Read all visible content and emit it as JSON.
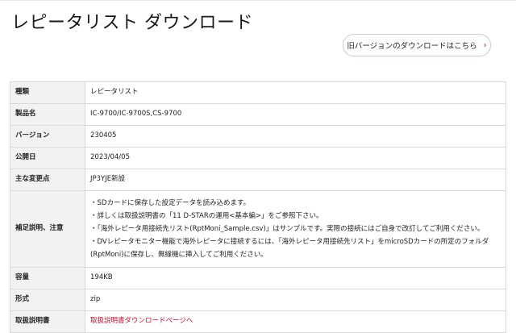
{
  "page": {
    "title": "レピータリスト ダウンロード",
    "old_version_button": "旧バージョンのダウンロードはこちら",
    "old_version_chevron": "›"
  },
  "spec": {
    "rows": [
      {
        "label": "種類",
        "value": "レピータリスト"
      },
      {
        "label": "製品名",
        "value": "IC-9700/IC-9700S,CS-9700"
      },
      {
        "label": "バージョン",
        "value": "230405"
      },
      {
        "label": "公開日",
        "value": "2023/04/05"
      },
      {
        "label": "主な変更点",
        "value": "JP3YJE新設"
      }
    ],
    "notes": {
      "label": "補足説明、注意",
      "lines": [
        "・SDカードに保存した設定データを読み込めます。",
        "・詳しくは取扱説明書の「11 D-STARの運用<基本編>」をご参照下さい。",
        "・「海外レピータ用接続先リスト(RptMoni_Sample.csv)」はサンプルです。実際の接続にはご自身で改訂してご利用ください。",
        "・DVレピータモニター機能で海外レピータに接続するには、「海外レピータ用接続先リスト」をmicroSDカードの所定のフォルダ(RptMoni)に保存し、無線機に挿入してご利用ください。"
      ]
    },
    "capacity": {
      "label": "容量",
      "value": "194KB"
    },
    "format": {
      "label": "形式",
      "value": "zip"
    },
    "manual": {
      "label": "取扱説明書",
      "link_text": "取扱説明書ダウンロードページへ"
    }
  },
  "colors": {
    "accent": "#c8102e",
    "label_bg": "#f2f2f2",
    "border": "#d9d9d9"
  }
}
